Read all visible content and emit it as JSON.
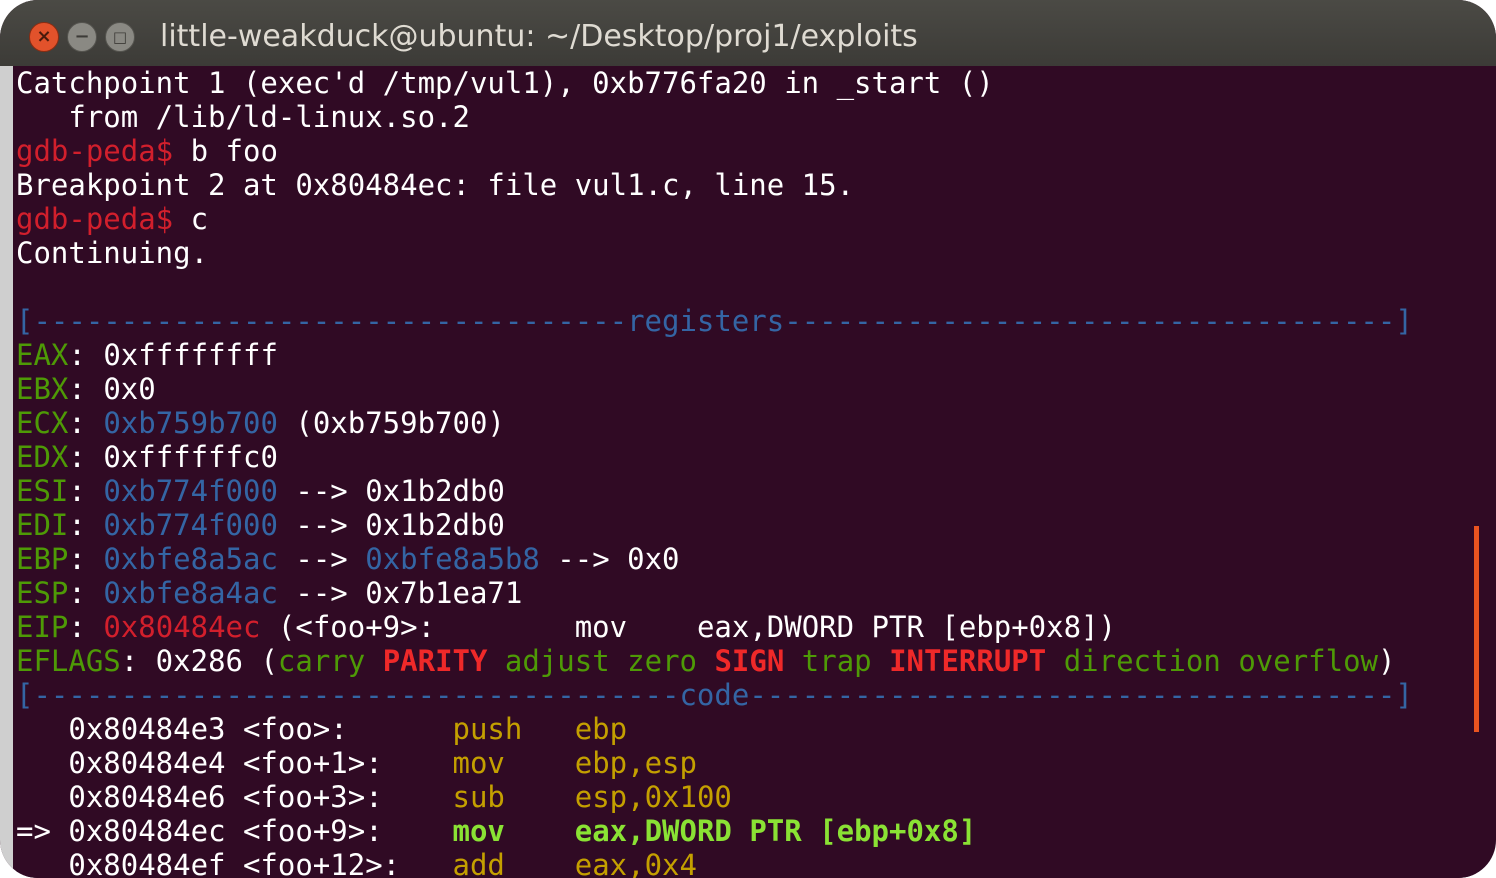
{
  "window": {
    "title": "little-weakduck@ubuntu: ~/Desktop/proj1/exploits"
  },
  "terminal": {
    "prompt": "gdb-peda$",
    "lines": {
      "catch1": "Catchpoint 1 (exec'd /tmp/vul1), 0xb776fa20 in _start ()",
      "catch2": "   from /lib/ld-linux.so.2",
      "cmd1": " b foo",
      "bp": "Breakpoint 2 at 0x80484ec: file vul1.c, line 15.",
      "cmd2": " c",
      "cont": "Continuing."
    },
    "registers_header": {
      "left": "[----------------------------------",
      "label": "registers",
      "right": "-----------------------------------]"
    },
    "registers": {
      "eax": {
        "name": "EAX",
        "sep": ": ",
        "value": "0xffffffff"
      },
      "ebx": {
        "name": "EBX",
        "sep": ": ",
        "value": "0x0"
      },
      "ecx": {
        "name": "ECX",
        "sep": ": ",
        "ptr": "0xb759b700",
        "rest": " (0xb759b700)"
      },
      "edx": {
        "name": "EDX",
        "sep": ": ",
        "value": "0xffffffc0"
      },
      "esi": {
        "name": "ESI",
        "sep": ": ",
        "ptr": "0xb774f000",
        "rest": " --> 0x1b2db0"
      },
      "edi": {
        "name": "EDI",
        "sep": ": ",
        "ptr": "0xb774f000",
        "rest": " --> 0x1b2db0"
      },
      "ebp": {
        "name": "EBP",
        "sep": ": ",
        "ptr": "0xbfe8a5ac",
        "mid": " --> ",
        "ptr2": "0xbfe8a5b8",
        "rest": " --> 0x0"
      },
      "esp": {
        "name": "ESP",
        "sep": ": ",
        "ptr": "0xbfe8a4ac",
        "rest": " --> 0x7b1ea71"
      },
      "eip": {
        "name": "EIP",
        "sep": ": ",
        "ptr": "0x80484ec",
        "rest": " (<foo+9>:        mov    eax,DWORD PTR [ebp+0x8])"
      }
    },
    "eflags": {
      "name": "EFLAGS",
      "value": ": 0x286 (",
      "carry": "carry",
      "parity": "PARITY",
      "adjust": "adjust",
      "zero": "zero",
      "sign": "SIGN",
      "trap": "trap",
      "interrupt": "INTERRUPT",
      "direction": "direction",
      "overflow": "overflow",
      "close": ")"
    },
    "code_header": {
      "left": "[-------------------------------------",
      "label": "code",
      "right": "-------------------------------------]"
    },
    "code": {
      "c1": {
        "addr": "   0x80484e3 <foo>:      ",
        "op": "push",
        "args": "   ebp"
      },
      "c2": {
        "addr": "   0x80484e4 <foo+1>:    ",
        "op": "mov",
        "args": "    ebp,esp"
      },
      "c3": {
        "addr": "   0x80484e6 <foo+3>:    ",
        "op": "sub",
        "args": "    esp,0x100"
      },
      "c4": {
        "arrow": "=> ",
        "addr": "0x80484ec <foo+9>:    ",
        "op": "mov",
        "args": "    eax,DWORD PTR [ebp+0x8]"
      },
      "c5": {
        "addr": "   0x80484ef <foo+12>:   ",
        "op": "add",
        "args": "    eax,0x4"
      }
    }
  },
  "colors": {
    "terminal_bg": "#300a24",
    "prompt": "#d21f2c",
    "register_name": "#4e9a06",
    "pointer": "#3465a4",
    "current_instruction": "#8ae234",
    "scroll_accent": "#e95420"
  }
}
